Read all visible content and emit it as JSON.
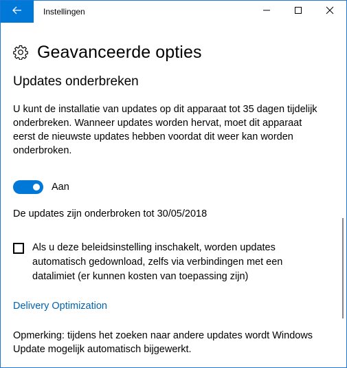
{
  "window": {
    "title": "Instellingen",
    "back_icon": "arrow-left-icon",
    "accent_color": "#0078d7"
  },
  "page": {
    "title": "Geavanceerde opties",
    "icon": "gear-icon"
  },
  "section": {
    "title": "Updates onderbreken",
    "description": "U kunt de installatie van updates op dit apparaat tot 35 dagen tijdelijk onderbreken. Wanneer updates worden hervat, moet dit apparaat eerst de nieuwste updates hebben voordat dit weer kan worden onderbroken.",
    "toggle": {
      "state": "on",
      "label": "Aan"
    },
    "paused_until": "De updates zijn onderbroken tot 30/05/2018"
  },
  "metered_option": {
    "checked": false,
    "label": "Als u deze beleidsinstelling inschakelt, worden updates automatisch gedownload, zelfs via verbindingen met een datalimiet (er kunnen kosten van toepassing zijn)"
  },
  "links": {
    "delivery_optimization": "Delivery Optimization",
    "link_color": "#0063b1"
  },
  "note": "Opmerking: tijdens het zoeken naar andere updates wordt Windows Update mogelijk automatisch bijgewerkt."
}
